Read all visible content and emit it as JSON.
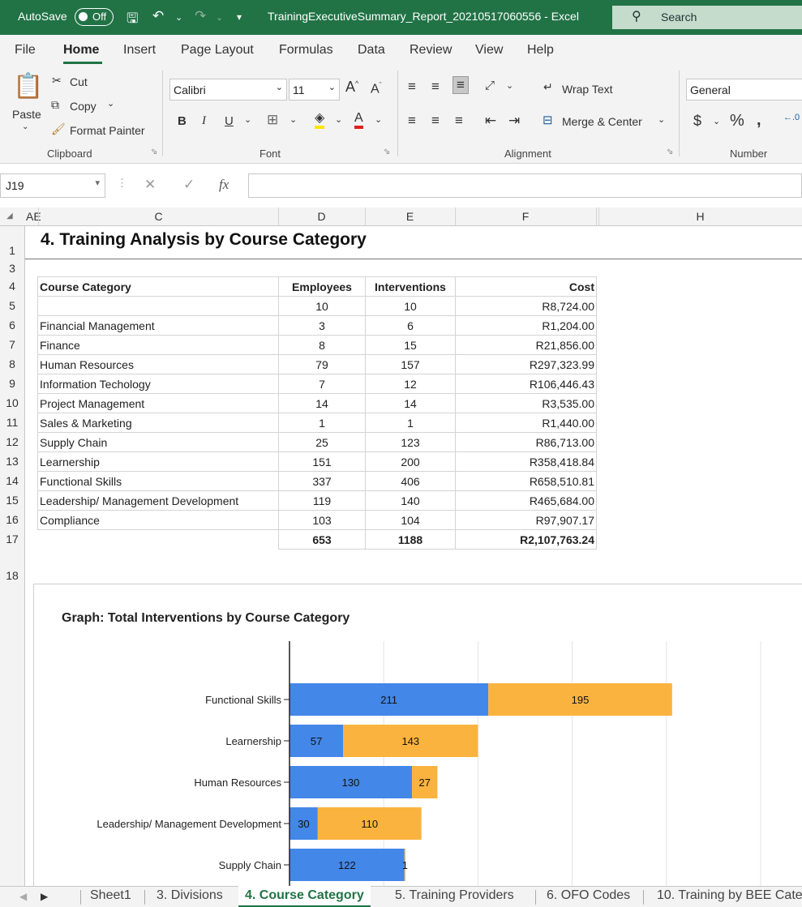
{
  "titlebar": {
    "autosave_label": "AutoSave",
    "autosave_state": "Off",
    "document_title": "TrainingExecutiveSummary_Report_20210517060556  -  Excel",
    "search_placeholder": "Search"
  },
  "menu": {
    "tabs": [
      "File",
      "Home",
      "Insert",
      "Page Layout",
      "Formulas",
      "Data",
      "Review",
      "View",
      "Help"
    ],
    "active": "Home"
  },
  "ribbon": {
    "clipboard": {
      "paste": "Paste",
      "cut": "Cut",
      "copy": "Copy",
      "format_painter": "Format Painter",
      "group_label": "Clipboard"
    },
    "font": {
      "name": "Calibri",
      "size": "11",
      "group_label": "Font"
    },
    "alignment": {
      "wrap_text": "Wrap Text",
      "merge_center": "Merge & Center",
      "group_label": "Alignment"
    },
    "number": {
      "format": "General",
      "group_label": "Number"
    }
  },
  "formula_bar": {
    "name_box": "J19",
    "fx": "fx",
    "content": ""
  },
  "columns": [
    "AE",
    "C",
    "D",
    "E",
    "F",
    "H"
  ],
  "rows": [
    "1",
    "3",
    "4",
    "5",
    "6",
    "7",
    "8",
    "9",
    "10",
    "11",
    "12",
    "13",
    "14",
    "15",
    "16",
    "17",
    "18"
  ],
  "sheet": {
    "title": "4. Training Analysis by Course Category",
    "table": {
      "headers": [
        "Course Category",
        "Employees",
        "Interventions",
        "Cost"
      ],
      "rows": [
        [
          "",
          "10",
          "10",
          "R8,724.00"
        ],
        [
          "Financial Management",
          "3",
          "6",
          "R1,204.00"
        ],
        [
          "Finance",
          "8",
          "15",
          "R21,856.00"
        ],
        [
          "Human Resources",
          "79",
          "157",
          "R297,323.99"
        ],
        [
          "Information Techology",
          "7",
          "12",
          "R106,446.43"
        ],
        [
          "Project Management",
          "14",
          "14",
          "R3,535.00"
        ],
        [
          "Sales & Marketing",
          "1",
          "1",
          "R1,440.00"
        ],
        [
          "Supply Chain",
          "25",
          "123",
          "R86,713.00"
        ],
        [
          "Learnership",
          "151",
          "200",
          "R358,418.84"
        ],
        [
          "Functional Skills",
          "337",
          "406",
          "R658,510.81"
        ],
        [
          "Leadership/ Management Development",
          "119",
          "140",
          "R465,684.00"
        ],
        [
          "Compliance",
          "103",
          "104",
          "R97,907.17"
        ]
      ],
      "totals": [
        "",
        "653",
        "1188",
        "R2,107,763.24"
      ]
    }
  },
  "chart_data": {
    "type": "bar",
    "orientation": "horizontal",
    "stacked": true,
    "title": "Graph: Total Interventions by Course Category",
    "categories": [
      "Functional Skills",
      "Learnership",
      "Human Resources",
      "Leadership/ Management Development",
      "Supply Chain"
    ],
    "series": [
      {
        "values": [
          211,
          57,
          130,
          30,
          122
        ],
        "color": "#4387e8"
      },
      {
        "values": [
          195,
          143,
          27,
          110,
          1
        ],
        "color": "#fbb33f"
      }
    ],
    "xlim": [
      0,
      500
    ],
    "grid": true
  },
  "sheet_tabs": {
    "tabs": [
      "Sheet1",
      "3. Divisions",
      "4. Course Category",
      "5. Training Providers",
      "6. OFO Codes",
      "10. Training by BEE Cate"
    ],
    "active": "4. Course Category"
  }
}
